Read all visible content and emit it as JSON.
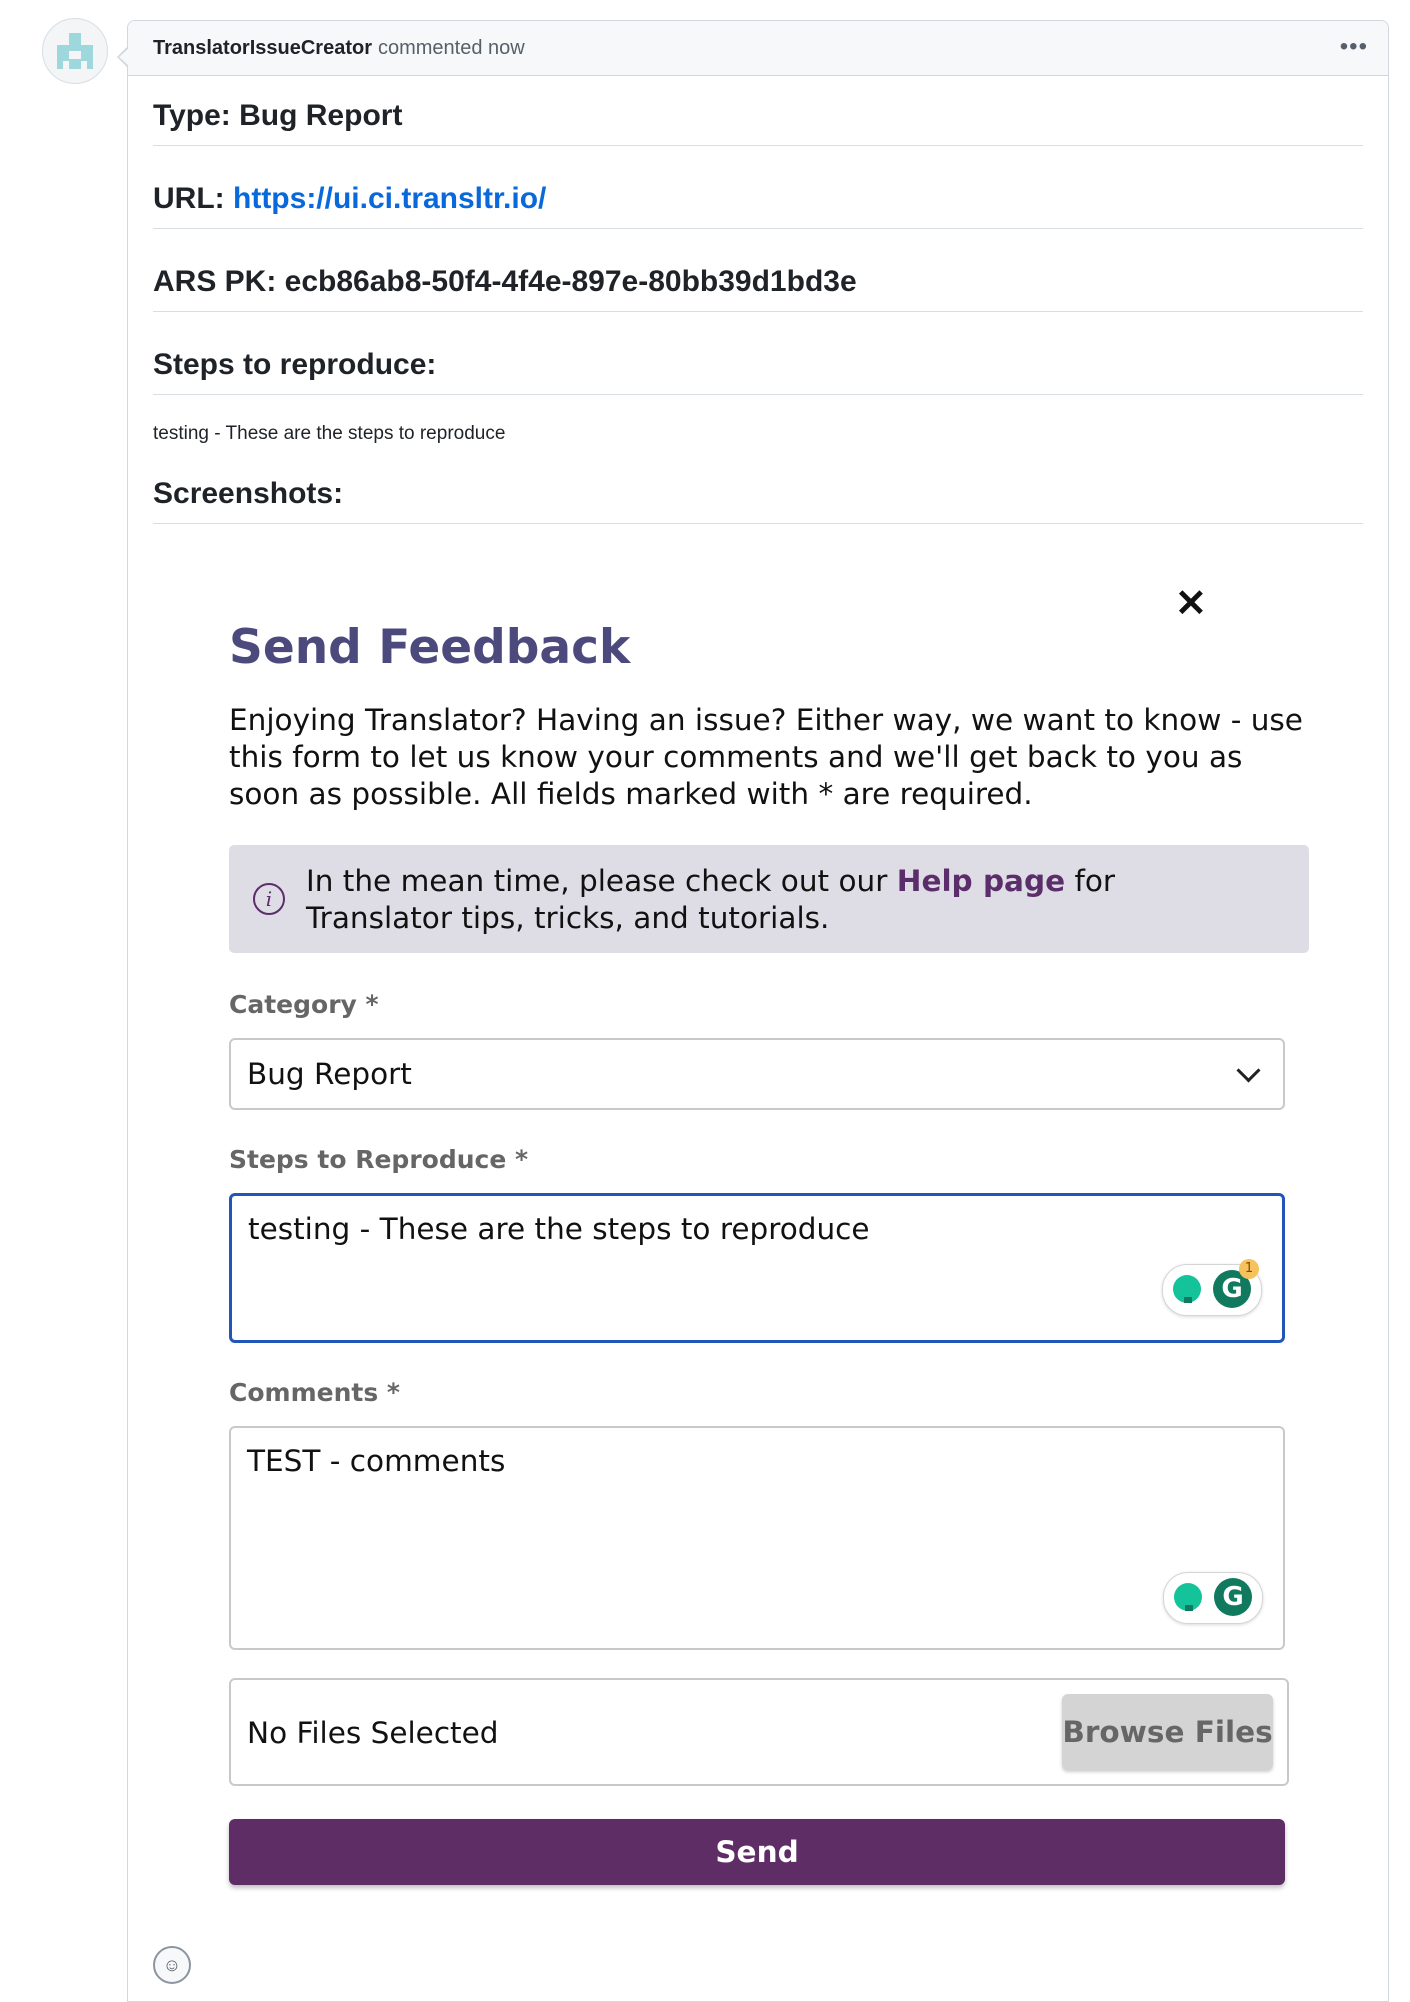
{
  "comment": {
    "author": "TranslatorIssueCreator",
    "meta": "commented now",
    "menu_icon": "kebab-horizontal-icon"
  },
  "body": {
    "type_heading": "Type: Bug Report",
    "url_label": "URL:",
    "url_link": "https://ui.ci.transltr.io/",
    "ars_heading": "ARS PK: ecb86ab8-50f4-4f4e-897e-80bb39d1bd3e",
    "steps_heading": "Steps to reproduce:",
    "steps_text": "testing - These are the steps to reproduce",
    "screenshots_heading": "Screenshots:"
  },
  "modal": {
    "close_glyph": "✕",
    "title": "Send Feedback",
    "intro": "Enjoying Translator? Having an issue? Either way, we want to know - use this form to let us know your comments and we'll get back to you as soon as possible. All fields marked with * are required.",
    "info_prefix": "In the mean time, please check out our ",
    "info_link": "Help page",
    "info_suffix": " for Translator tips, tricks, and tutorials.",
    "info_icon_glyph": "i",
    "category_label": "Category *",
    "category_value": "Bug Report",
    "steps_label": "Steps to Reproduce *",
    "steps_value": "testing - These are the steps to reproduce",
    "comments_label": "Comments *",
    "comments_value": "TEST - comments",
    "grammarly_badge_count": "1",
    "grammarly_letter": "G",
    "no_files": "No Files Selected",
    "browse_label": "Browse Files",
    "send_label": "Send"
  },
  "colors": {
    "title": "#4c4a7d",
    "link": "#0969da",
    "brand_purple": "#5f2d66",
    "info_bg": "#dedde6",
    "focus_border": "#2155b8"
  }
}
